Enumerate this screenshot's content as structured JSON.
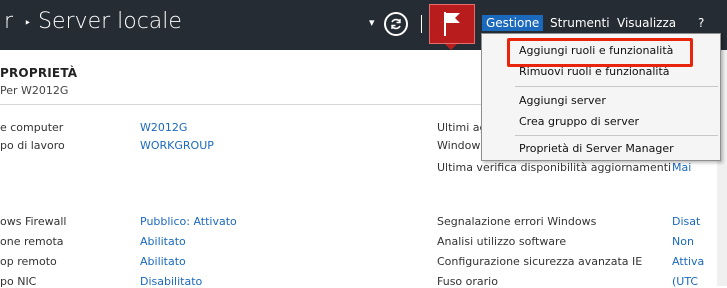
{
  "header": {
    "app_title": "r",
    "separator": "‣",
    "page_title": "Server locale",
    "dropdown_glyph": "▾",
    "menu": [
      "Gestione",
      "Strumenti",
      "Visualizza",
      "?"
    ],
    "active_menu": "Gestione",
    "flag_color": "#b81c1c"
  },
  "properties": {
    "title": "PROPRIETÀ",
    "subtitle": "Per W2012G",
    "rows_left": [
      {
        "label": "e computer",
        "value": "W2012G"
      },
      {
        "label": "po di lavoro",
        "value": "WORKGROUP"
      },
      {
        "label": "ows Firewall",
        "value": "Pubblico: Attivato"
      },
      {
        "label": "one remota",
        "value": "Abilitato"
      },
      {
        "label": "op remoto",
        "value": "Abilitato"
      },
      {
        "label": "po NIC",
        "value": "Disabilitato"
      }
    ],
    "rows_right": [
      {
        "label": "Ultimi ag",
        "value": ""
      },
      {
        "label": "Window",
        "value": ""
      },
      {
        "label": "Ultima verifica disponibilità aggiornamenti",
        "value": "Mai"
      },
      {
        "label": "Segnalazione errori Windows",
        "value": "Disat"
      },
      {
        "label": "Analisi utilizzo software",
        "value": "Non"
      },
      {
        "label": "Configurazione sicurezza avanzata IE",
        "value": "Attiva"
      },
      {
        "label": "Fuso orario",
        "value": "(UTC"
      }
    ]
  },
  "gestione_menu": {
    "items": [
      "Aggiungi ruoli e funzionalità",
      "Rimuovi ruoli e funzionalità",
      "Aggiungi server",
      "Crea gruppo di server",
      "Proprietà di Server Manager"
    ],
    "highlighted": "Aggiungi ruoli e funzionalità",
    "highlight_color": "#e8250a"
  },
  "colors": {
    "header_bg": "#252c34",
    "accent": "#1b69bd",
    "menu_bg": "#f5f5f5"
  }
}
